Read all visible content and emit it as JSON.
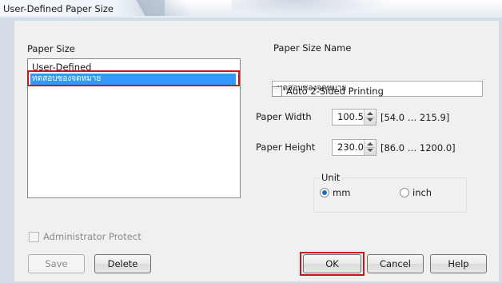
{
  "window": {
    "title": "User-Defined Paper Size"
  },
  "paper_size": {
    "label": "Paper Size",
    "items": [
      {
        "label": "User-Defined",
        "selected": false
      },
      {
        "label": "ทดสอบซองจดหมาย",
        "selected": true
      }
    ]
  },
  "paper_size_name": {
    "label": "Paper Size Name",
    "value": "ทดสอบซองจดหมาย"
  },
  "auto_duplex": {
    "label": "Auto 2-Sided Printing",
    "checked": false
  },
  "paper_width": {
    "label": "Paper Width",
    "value": "100.5",
    "range": "[54.0 … 215.9]"
  },
  "paper_height": {
    "label": "Paper Height",
    "value": "230.0",
    "range": "[86.0 … 1200.0]"
  },
  "unit": {
    "label": "Unit",
    "options": [
      "mm",
      "inch"
    ],
    "selected": "mm"
  },
  "admin_protect": {
    "label": "Administrator Protect",
    "checked": false,
    "enabled": false
  },
  "buttons": {
    "save": "Save",
    "delete": "Delete",
    "ok": "OK",
    "cancel": "Cancel",
    "help": "Help"
  },
  "colors": {
    "highlight": "#d0121b",
    "selection": "#3399ff"
  }
}
